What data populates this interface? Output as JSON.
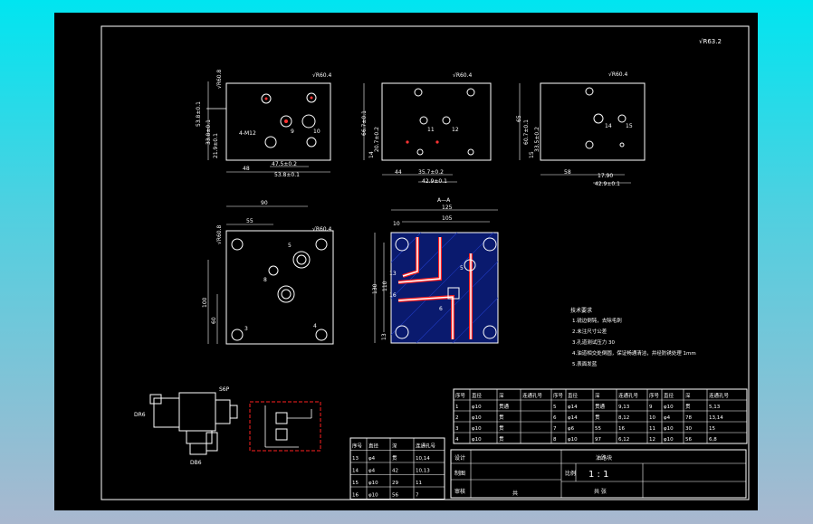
{
  "drawing": {
    "roughness_corner": "√R63.2",
    "roughness_view": "√R60.4",
    "roughness_small": "√R60.8",
    "view1": {
      "dims": [
        "53.8±0.1",
        "33.8±0.1",
        "21.9±0.1",
        "47.5±0.2",
        "53.8±0.1",
        "48"
      ],
      "port_labels": [
        "9",
        "10",
        "12"
      ],
      "thread": "4-M12"
    },
    "view2": {
      "dims": [
        "66.7±0.1",
        "14",
        "20.7±0.2",
        "44",
        "35.7±0.2",
        "42.9±0.1"
      ],
      "port_labels": [
        "11",
        "12"
      ]
    },
    "view3": {
      "dims": [
        "65",
        "60.7±0.1",
        "15",
        "33.5±0.2",
        "58",
        "17.90",
        "42.9±0.1"
      ],
      "port_labels": [
        "14",
        "15"
      ]
    },
    "view4": {
      "dims": [
        "90",
        "55",
        "100",
        "60"
      ],
      "port_labels": [
        "5",
        "8",
        "3",
        "4"
      ]
    },
    "section": {
      "title": "A—A",
      "dims": [
        "125",
        "105",
        "130",
        "110",
        "10",
        "13"
      ],
      "port_labels": [
        "5",
        "6",
        "13",
        "16"
      ]
    },
    "valve_labels": [
      "DR6",
      "S6P",
      "DB6"
    ],
    "notes": [
      "技术要求",
      "1.锐边倒钝，去除毛刺",
      "2.未注尺寸公差",
      "3.孔道测试压力 30",
      "4.油道相交处倒圆，保证畅通清洁，并经防锈处理 1mm",
      "5.表面发蓝"
    ]
  },
  "table_main": {
    "headers": [
      "序号",
      "直径",
      "深",
      "连通孔号",
      "序号",
      "直径",
      "深",
      "连通孔号",
      "序号",
      "直径",
      "深",
      "连通孔号"
    ],
    "rows": [
      [
        "1",
        "φ10",
        "贯通",
        "",
        "5",
        "φ14",
        "贯通",
        "9,13",
        "9",
        "φ10",
        "贯",
        "5,13"
      ],
      [
        "2",
        "φ10",
        "贯",
        "",
        "6",
        "φ14",
        "贯",
        "8,12",
        "10",
        "φ4",
        "78",
        "13,14"
      ],
      [
        "3",
        "φ10",
        "贯",
        "",
        "7",
        "φ6",
        "55",
        "16",
        "11",
        "φ10",
        "30",
        "15"
      ],
      [
        "4",
        "φ10",
        "贯",
        "",
        "8",
        "φ10",
        "97",
        "6,12",
        "12",
        "φ10",
        "56",
        "6,8"
      ]
    ]
  },
  "table_small": {
    "headers": [
      "序号",
      "直径",
      "深",
      "连通孔号"
    ],
    "rows": [
      [
        "13",
        "φ4",
        "贯",
        "10,14"
      ],
      [
        "14",
        "φ4",
        "42",
        "10,13"
      ],
      [
        "15",
        "φ10",
        "29",
        "11"
      ],
      [
        "16",
        "φ10",
        "56",
        "7"
      ]
    ]
  },
  "title_block": {
    "part_name": "油路块",
    "scale_label": "比例",
    "scale": "1 : 1",
    "quantity": "共  张",
    "labels": [
      "设计",
      "制图",
      "审核",
      "班级"
    ],
    "count": "共"
  },
  "colors": {
    "accent_red": "#ff2020",
    "section_fill": "#0a1a6e",
    "line": "#ffffff"
  }
}
